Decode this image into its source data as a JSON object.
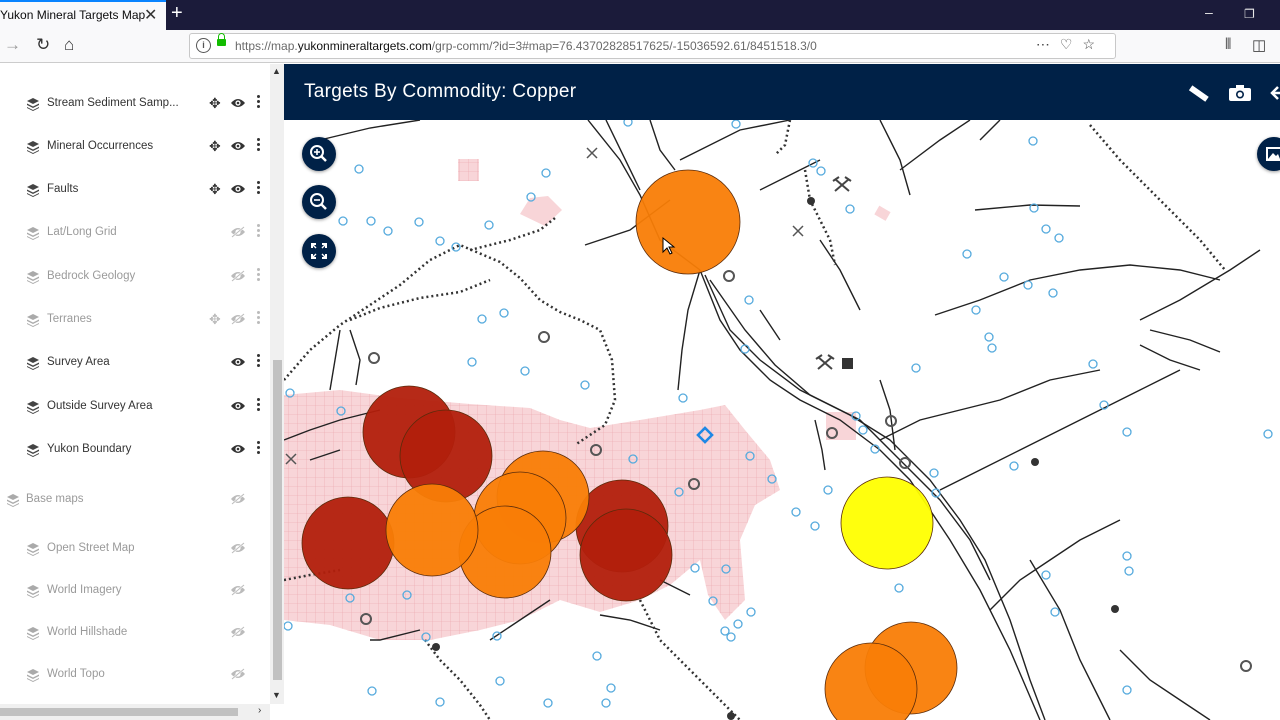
{
  "browser": {
    "tab_title": "Yukon Mineral Targets Map",
    "url_prefix": "https://map.",
    "url_domain": "yukonmineraltargets.com",
    "url_path": "/grp-comm/?id=3#map=76.43702828517625/-15036592.61/8451518.3/0"
  },
  "map": {
    "title": "Targets By Commodity: Copper",
    "colors": {
      "header": "#002147",
      "claims": "#f6c9cc",
      "target_high": "#b01e0e",
      "target_mid": "#f97d06",
      "target_low": "#ffff00",
      "sample": "#55aadd"
    }
  },
  "layers": [
    {
      "label": "Stream Sediment Samp...",
      "movable": true,
      "visible": true
    },
    {
      "label": "Mineral Occurrences",
      "movable": true,
      "visible": true
    },
    {
      "label": "Faults",
      "movable": true,
      "visible": true
    },
    {
      "label": "Lat/Long Grid",
      "movable": false,
      "visible": false
    },
    {
      "label": "Bedrock Geology",
      "movable": false,
      "visible": false
    },
    {
      "label": "Terranes",
      "movable": true,
      "visible": false
    },
    {
      "label": "Survey Area",
      "movable": false,
      "visible": true
    },
    {
      "label": "Outside Survey Area",
      "movable": false,
      "visible": true
    },
    {
      "label": "Yukon Boundary",
      "movable": false,
      "visible": true
    }
  ],
  "basemaps_header": "Base maps",
  "basemaps": [
    {
      "label": "Open Street Map"
    },
    {
      "label": "World Imagery"
    },
    {
      "label": "World Hillshade"
    },
    {
      "label": "World Topo"
    }
  ]
}
